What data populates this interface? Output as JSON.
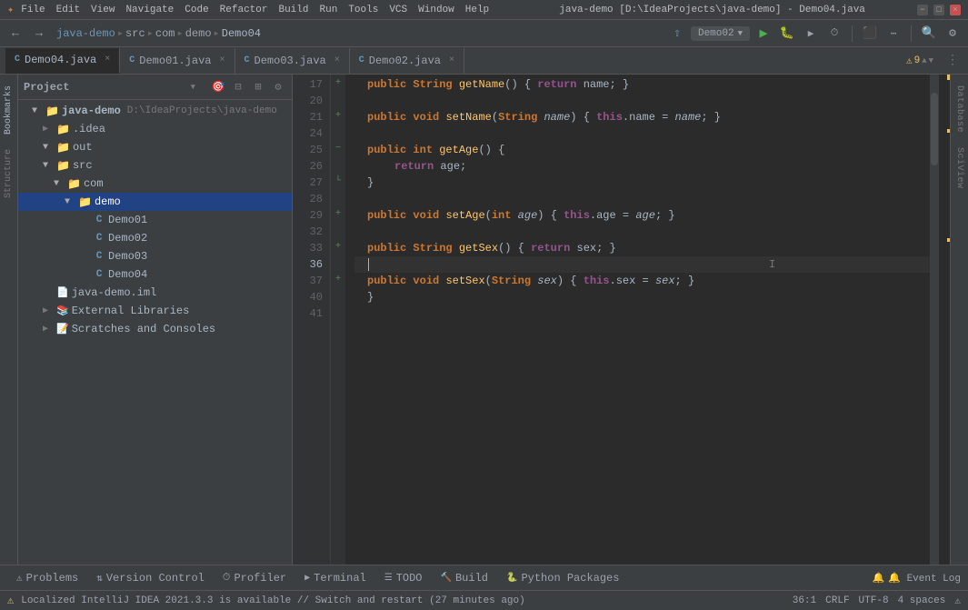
{
  "titleBar": {
    "menuItems": [
      "File",
      "Edit",
      "View",
      "Navigate",
      "Code",
      "Refactor",
      "Build",
      "Run",
      "Tools",
      "VCS",
      "Window",
      "Help"
    ],
    "title": "java-demo [D:\\IdeaProjects\\java-demo] - Demo04.java",
    "windowControls": [
      "-",
      "□",
      "×"
    ]
  },
  "toolbar": {
    "breadcrumb": [
      "java-demo",
      "src",
      "com",
      "demo",
      "Demo04"
    ],
    "breadcrumbSeps": [
      "▸",
      "▸",
      "▸",
      "▸"
    ],
    "runConfig": "Demo02",
    "searchIcon": "🔍",
    "backIcon": "←",
    "forwardIcon": "→"
  },
  "tabs": [
    {
      "label": "Demo04.java",
      "active": true,
      "icon": "C"
    },
    {
      "label": "Demo01.java",
      "active": false,
      "icon": "C"
    },
    {
      "label": "Demo03.java",
      "active": false,
      "icon": "C"
    },
    {
      "label": "Demo02.java",
      "active": false,
      "icon": "C"
    }
  ],
  "warningBadge": "⚠ 9",
  "sidebar": {
    "title": "Project",
    "items": [
      {
        "indent": 0,
        "arrow": "▼",
        "icon": "project",
        "label": "java-demo",
        "extra": "D:\\IdeaProjects\\java-demo",
        "selected": false
      },
      {
        "indent": 1,
        "arrow": "▶",
        "icon": "folder",
        "label": ".idea",
        "selected": false
      },
      {
        "indent": 1,
        "arrow": "▼",
        "icon": "folder",
        "label": "out",
        "selected": false
      },
      {
        "indent": 1,
        "arrow": "▼",
        "icon": "folder",
        "label": "src",
        "selected": false
      },
      {
        "indent": 2,
        "arrow": "▼",
        "icon": "folder",
        "label": "com",
        "selected": false
      },
      {
        "indent": 3,
        "arrow": "▼",
        "icon": "folder",
        "label": "demo",
        "selected": true
      },
      {
        "indent": 4,
        "arrow": "",
        "icon": "java",
        "label": "Demo01",
        "selected": false
      },
      {
        "indent": 4,
        "arrow": "",
        "icon": "java",
        "label": "Demo02",
        "selected": false
      },
      {
        "indent": 4,
        "arrow": "",
        "icon": "java",
        "label": "Demo03",
        "selected": false
      },
      {
        "indent": 4,
        "arrow": "",
        "icon": "java",
        "label": "Demo04",
        "selected": false
      },
      {
        "indent": 1,
        "arrow": "",
        "icon": "iml",
        "label": "java-demo.iml",
        "selected": false
      },
      {
        "indent": 1,
        "arrow": "▶",
        "icon": "lib",
        "label": "External Libraries",
        "selected": false
      },
      {
        "indent": 1,
        "arrow": "▶",
        "icon": "scratch",
        "label": "Scratches and Consoles",
        "selected": false
      }
    ]
  },
  "leftEdgeTabs": [
    "Bookmarks",
    "Structure"
  ],
  "rightEdgeTabs": [
    "Database",
    "SciView"
  ],
  "editor": {
    "lines": [
      {
        "num": 17,
        "hasFold": true,
        "foldType": "expand",
        "content": "public_String_getName()_{_return_name;_}"
      },
      {
        "num": 20,
        "hasFold": false,
        "foldType": "",
        "content": ""
      },
      {
        "num": 21,
        "hasFold": true,
        "foldType": "expand",
        "content": "public_void_setName(String_name)_{_this.name_=_name;_}"
      },
      {
        "num": 24,
        "hasFold": false,
        "foldType": "",
        "content": ""
      },
      {
        "num": 25,
        "hasFold": true,
        "foldType": "collapse",
        "content": "public_int_getAge()_{"
      },
      {
        "num": 26,
        "hasFold": false,
        "foldType": "",
        "content": "    return_age;"
      },
      {
        "num": 27,
        "hasFold": true,
        "foldType": "close",
        "content": "}"
      },
      {
        "num": 28,
        "hasFold": false,
        "foldType": "",
        "content": ""
      },
      {
        "num": 29,
        "hasFold": true,
        "foldType": "expand",
        "content": "public_void_setAge(int_age)_{_this.age_=_age;_}"
      },
      {
        "num": 32,
        "hasFold": false,
        "foldType": "",
        "content": ""
      },
      {
        "num": 33,
        "hasFold": true,
        "foldType": "expand",
        "content": "public_String_getSex()_{_return_sex;_}"
      },
      {
        "num": 36,
        "hasFold": false,
        "foldType": "",
        "content": "cursor",
        "isCurrent": true
      },
      {
        "num": 37,
        "hasFold": true,
        "foldType": "expand",
        "content": "public_void_setSex(String_sex)_{_this.sex_=_sex;_}"
      },
      {
        "num": 40,
        "hasFold": false,
        "foldType": "",
        "content": "}"
      },
      {
        "num": 41,
        "hasFold": false,
        "foldType": "",
        "content": ""
      }
    ]
  },
  "bottomTabs": [
    {
      "icon": "⚠",
      "label": "Problems"
    },
    {
      "icon": "⎇",
      "label": "Version Control"
    },
    {
      "icon": "⏱",
      "label": "Profiler"
    },
    {
      "icon": "▶",
      "label": "Terminal"
    },
    {
      "icon": "☰",
      "label": "TODO"
    },
    {
      "icon": "🔨",
      "label": "Build"
    },
    {
      "icon": "🐍",
      "label": "Python Packages"
    }
  ],
  "eventLog": "🔔 Event Log",
  "statusBar": {
    "message": "Localized IntelliJ IDEA 2021.3.3 is available // Switch and restart (27 minutes ago)",
    "position": "36:1",
    "lineEnding": "CRLF",
    "encoding": "UTF-8",
    "indent": "4 spaces",
    "warnIcon": "⚠"
  }
}
